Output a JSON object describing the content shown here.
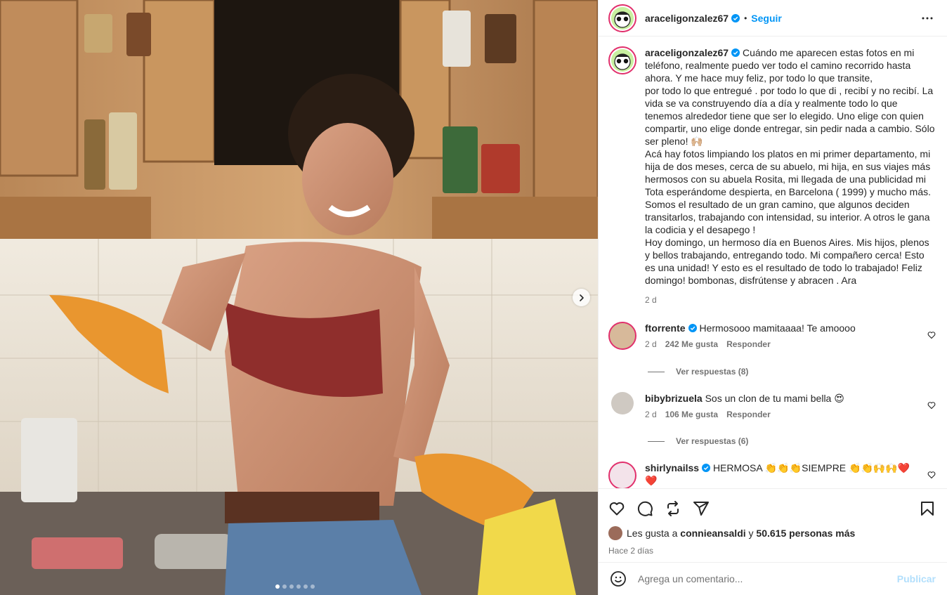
{
  "post": {
    "username": "araceligonzalez67",
    "follow_label": "Seguir",
    "separator": "•"
  },
  "caption": {
    "username": "araceligonzalez67",
    "text": "Cuándo me aparecen estas fotos en mi teléfono, realmente puedo ver todo el camino recorrido hasta ahora. Y me hace muy feliz, por todo lo que transite,\npor todo lo que entregué . por todo lo que di , recibí y no recibí. La vida se va construyendo día a día y realmente todo lo que tenemos alrededor tiene que ser lo elegido. Uno elige con quien compartir, uno elige donde entregar, sin pedir nada a cambio. Sólo ser pleno! 🙌🏼\nAcá hay fotos limpiando los platos en mi primer departamento, mi hija de dos meses, cerca de su abuelo, mi hija, en sus viajes más hermosos con su abuela Rosita, mi llegada de una publicidad mi Tota esperándome despierta, en Barcelona ( 1999) y mucho más.\nSomos el resultado de un gran camino, que algunos deciden transitarlos, trabajando con intensidad, su interior. A otros le gana la codicia y el desapego !\nHoy domingo, un hermoso día en Buenos Aires. Mis hijos, plenos y bellos trabajando, entregando todo. Mi compañero cerca! Esto es una unidad! Y esto es el resultado de todo lo trabajado! Feliz domingo! bombonas, disfrútense y abracen . Ara",
    "time": "2 d"
  },
  "comments": [
    {
      "username": "ftorrente",
      "verified": true,
      "text": "Hermosooo mamitaaaa! Te amoooo",
      "time": "2 d",
      "likes": "242 Me gusta",
      "reply_label": "Responder",
      "replies_label": "Ver respuestas (8)"
    },
    {
      "username": "bibybrizuela",
      "verified": false,
      "text": "Sos un clon de tu mami bella 😍",
      "time": "2 d",
      "likes": "106 Me gusta",
      "reply_label": "Responder",
      "replies_label": "Ver respuestas (6)"
    },
    {
      "username": "shirlynailss",
      "verified": true,
      "text": "HERMOSA 👏👏👏SIEMPRE 👏👏🙌🙌❤️❤️"
    }
  ],
  "likes": {
    "prefix": "Les gusta a",
    "user": "connieansaldi",
    "connector": "y",
    "count": "50.615 personas más"
  },
  "ago": "Hace 2 días",
  "add_comment": {
    "placeholder": "Agrega un comentario...",
    "publish_label": "Publicar"
  },
  "carousel": {
    "slide_count": 6,
    "active_index": 0
  },
  "colors": {
    "link": "#0095f6",
    "text": "#262626",
    "muted": "#737373",
    "publish_disabled": "#b2dffc"
  }
}
